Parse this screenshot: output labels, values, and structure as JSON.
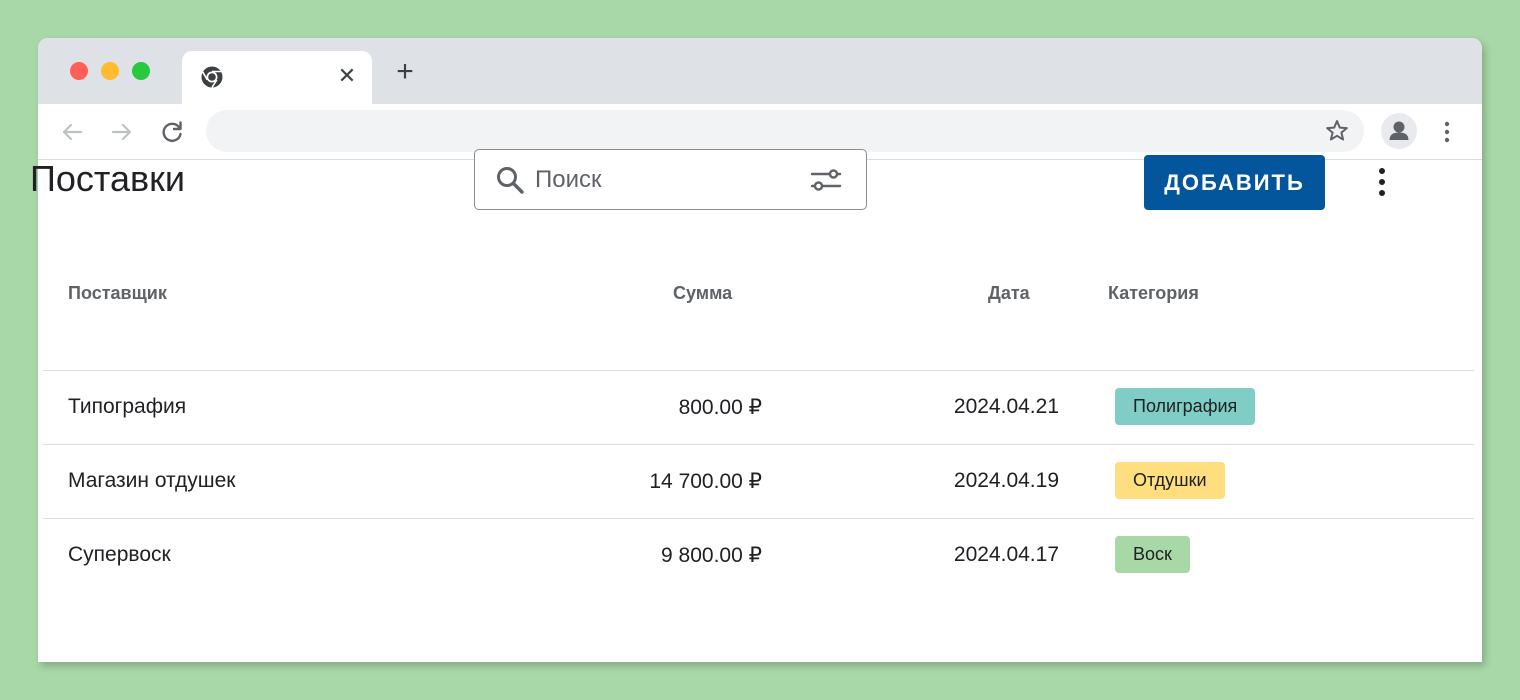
{
  "colors": {
    "background": "#a8d8a8",
    "primary_button": "#03569c",
    "chip_printing": "#7fcdc5",
    "chip_fragrance": "#ffde7f",
    "chip_wax": "#a8d8a8"
  },
  "browser": {
    "tab": {
      "favicon": "chrome-icon",
      "close_icon": "close-icon"
    },
    "toolbar": {
      "back_icon": "arrow-left-icon",
      "forward_icon": "arrow-right-icon",
      "reload_icon": "reload-icon",
      "address": "",
      "bookmark_icon": "star-icon",
      "profile_icon": "avatar-icon",
      "menu_icon": "more-vertical-icon"
    }
  },
  "page": {
    "title": "Поставки",
    "search": {
      "placeholder": "Поиск",
      "value": "",
      "icon": "search-icon",
      "filter_icon": "filter-sliders-icon"
    },
    "add_button": "ДОБАВИТЬ",
    "menu_icon": "more-vertical-icon"
  },
  "table": {
    "headers": {
      "supplier": "Поставщик",
      "amount": "Сумма",
      "date": "Дата",
      "category": "Категория"
    },
    "rows": [
      {
        "supplier": "Типография",
        "amount": "800.00 ₽",
        "date": "2024.04.21",
        "category": "Полиграфия"
      },
      {
        "supplier": "Магазин отдушек",
        "amount": "14 700.00 ₽",
        "date": "2024.04.19",
        "category": "Отдушки"
      },
      {
        "supplier": "Супервоск",
        "amount": "9 800.00 ₽",
        "date": "2024.04.17",
        "category": "Воск"
      }
    ]
  }
}
